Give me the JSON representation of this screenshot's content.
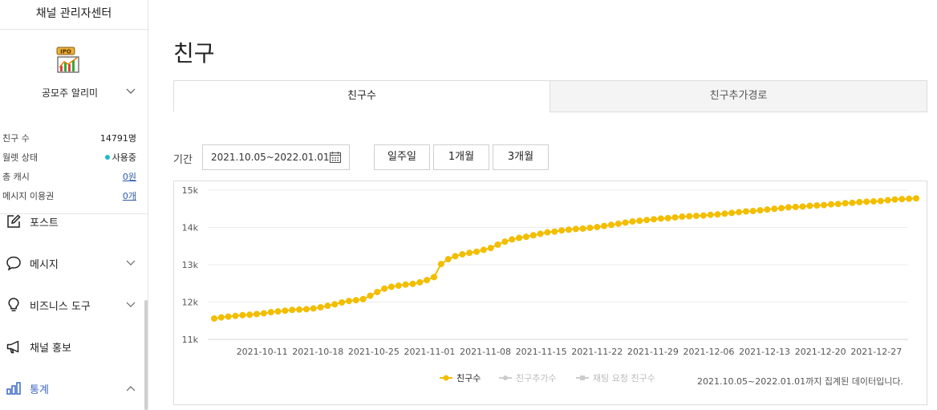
{
  "sidebar": {
    "title": "채널 관리자센터",
    "channel_logo_text": "IPO",
    "channel_name": "공모주 알리미",
    "stats": [
      {
        "label": "친구 수",
        "value": "14791명"
      },
      {
        "label": "월렛 상태",
        "value": "사용중"
      },
      {
        "label": "총 캐시",
        "value": "0원"
      },
      {
        "label": "메시지 이용권",
        "value": "0개"
      }
    ],
    "nav": [
      {
        "label": "포스트",
        "icon": "edit-icon"
      },
      {
        "label": "메시지",
        "icon": "speech-bubble-icon"
      },
      {
        "label": "비즈니스 도구",
        "icon": "lightbulb-icon"
      },
      {
        "label": "채널 홍보",
        "icon": "megaphone-icon"
      },
      {
        "label": "통계",
        "icon": "bar-chart-icon"
      }
    ]
  },
  "main": {
    "title": "친구",
    "tabs": [
      {
        "label": "친구수"
      },
      {
        "label": "친구추가경로"
      }
    ],
    "filter": {
      "period_label": "기간",
      "date_range": "2021.10.05~2022.01.01",
      "buttons": [
        {
          "label": "일주일"
        },
        {
          "label": "1개월"
        },
        {
          "label": "3개월"
        }
      ]
    },
    "note": "2021.10.05~2022.01.01까지 집계된 데이터입니다."
  },
  "colors": {
    "accent": "#f2be00",
    "inactive_series": "#cccccc",
    "active_nav": "#3b69c6",
    "wallet_dot": "#1fb8d0"
  },
  "chart_data": {
    "type": "line",
    "y_tick_labels": [
      "11k",
      "12k",
      "13k",
      "14k",
      "15k"
    ],
    "ylim": [
      11000,
      15000
    ],
    "x_tick_labels": [
      "2021-10-11",
      "2021-10-18",
      "2021-10-25",
      "2021-11-01",
      "2021-11-08",
      "2021-11-15",
      "2021-11-22",
      "2021-11-29",
      "2021-12-06",
      "2021-12-13",
      "2021-12-20",
      "2021-12-27"
    ],
    "x_start": "2021-10-05",
    "x_end": "2022-01-01",
    "grid": true,
    "legend_position": "bottom",
    "series": [
      {
        "name": "친구수",
        "active": true,
        "values": [
          11560,
          11590,
          11610,
          11630,
          11650,
          11660,
          11680,
          11700,
          11730,
          11750,
          11770,
          11790,
          11800,
          11810,
          11830,
          11860,
          11900,
          11940,
          11990,
          12030,
          12050,
          12080,
          12170,
          12270,
          12360,
          12410,
          12440,
          12470,
          12490,
          12530,
          12590,
          12670,
          13020,
          13150,
          13230,
          13280,
          13320,
          13350,
          13400,
          13450,
          13540,
          13620,
          13680,
          13720,
          13750,
          13790,
          13830,
          13870,
          13890,
          13920,
          13940,
          13960,
          13970,
          13990,
          14010,
          14040,
          14070,
          14100,
          14130,
          14160,
          14180,
          14200,
          14220,
          14240,
          14250,
          14270,
          14290,
          14300,
          14310,
          14320,
          14340,
          14350,
          14370,
          14390,
          14410,
          14430,
          14440,
          14460,
          14480,
          14500,
          14520,
          14540,
          14550,
          14560,
          14580,
          14590,
          14600,
          14620,
          14630,
          14650,
          14660,
          14680,
          14690,
          14700,
          14710,
          14730,
          14750,
          14760,
          14770,
          14780
        ]
      },
      {
        "name": "친구추가수",
        "active": false,
        "values": []
      },
      {
        "name": "채팅 요청 친구수",
        "active": false,
        "values": []
      }
    ]
  }
}
